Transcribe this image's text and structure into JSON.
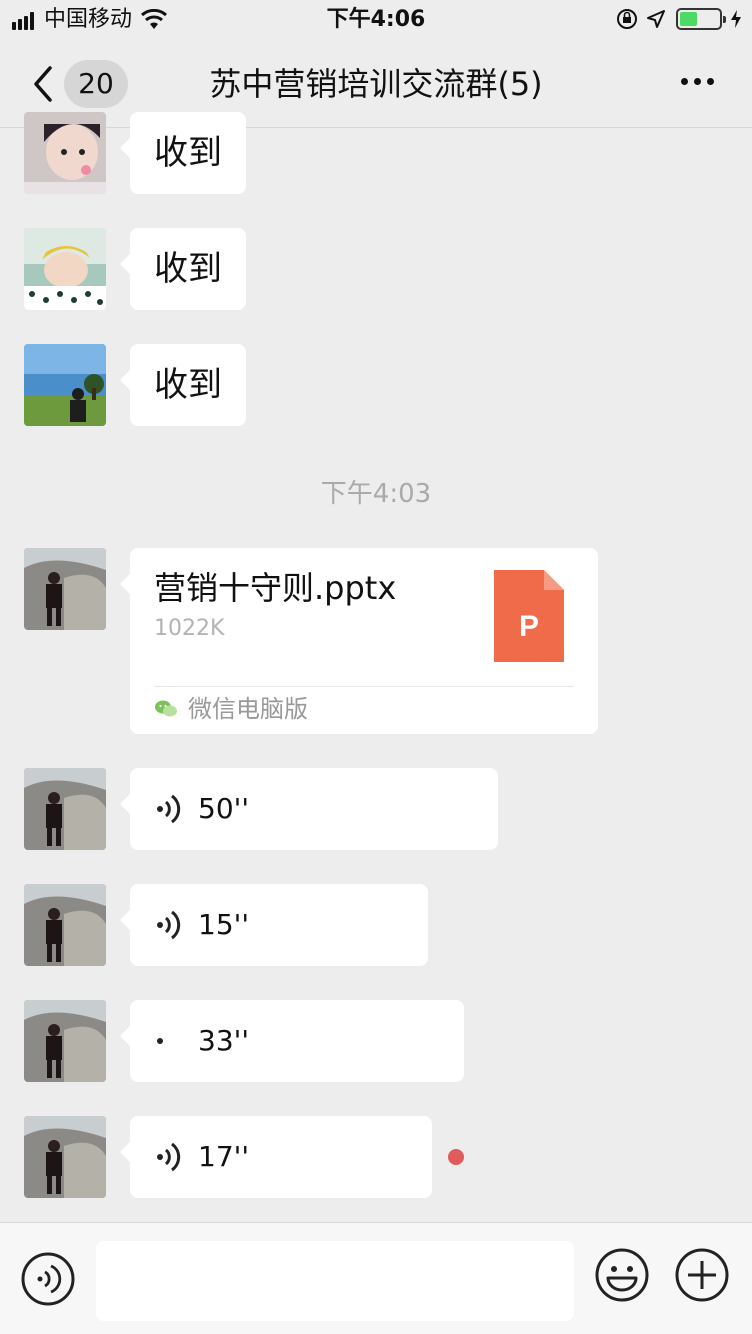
{
  "status_bar": {
    "carrier": "中国移动",
    "time": "下午4:06",
    "battery_level": 0.45
  },
  "nav": {
    "unread_count": "20",
    "title": "苏中营销培训交流群(5)"
  },
  "messages": {
    "text_1": "收到",
    "text_2": "收到",
    "text_3": "收到",
    "timestamp": "下午4:03",
    "file": {
      "name": "营销十守则.pptx",
      "size": "1022K",
      "icon_letter": "P",
      "source": "微信电脑版"
    },
    "voice_1": "50''",
    "voice_2": "15''",
    "voice_3": "33''",
    "voice_4": "17''"
  },
  "colors": {
    "background": "#ededed",
    "bubble": "#ffffff",
    "file_icon": "#ef6b4a",
    "unread_dot": "#e05b5b",
    "battery": "#4cd964"
  },
  "input_bar": {
    "placeholder": ""
  }
}
